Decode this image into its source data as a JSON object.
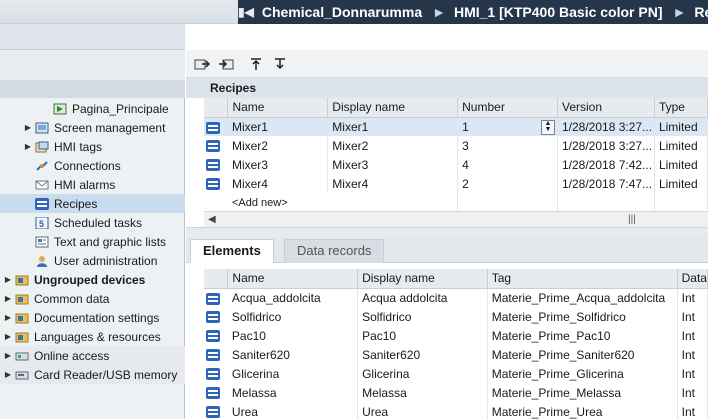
{
  "breadcrumb": {
    "items": [
      "Chemical_Donnarumma",
      "HMI_1 [KTP400 Basic color PN]",
      "Re"
    ],
    "separator": "►"
  },
  "tree": {
    "items": [
      {
        "label": "Pagina_Principale",
        "icon": "screen-icon"
      },
      {
        "label": "Screen management",
        "icon": "screen-management-icon"
      },
      {
        "label": "HMI tags",
        "icon": "tags-icon"
      },
      {
        "label": "Connections",
        "icon": "connections-icon"
      },
      {
        "label": "HMI alarms",
        "icon": "alarms-icon"
      },
      {
        "label": "Recipes",
        "icon": "recipes-icon"
      },
      {
        "label": "Scheduled tasks",
        "icon": "scheduled-tasks-icon"
      },
      {
        "label": "Text and graphic lists",
        "icon": "text-lists-icon"
      },
      {
        "label": "User administration",
        "icon": "user-admin-icon"
      },
      {
        "label": "Ungrouped devices",
        "icon": "folder-icon"
      },
      {
        "label": "Common data",
        "icon": "folder-icon"
      },
      {
        "label": "Documentation settings",
        "icon": "folder-icon"
      },
      {
        "label": "Languages & resources",
        "icon": "folder-icon"
      },
      {
        "label": "Online access",
        "icon": "online-icon"
      },
      {
        "label": "Card Reader/USB memory",
        "icon": "card-reader-icon"
      }
    ]
  },
  "recipes": {
    "title": "Recipes",
    "columns": [
      "Name",
      "Display name",
      "Number",
      "Version",
      "Type"
    ],
    "rows": [
      {
        "name": "Mixer1",
        "display": "Mixer1",
        "number": "1",
        "version": "1/28/2018 3:27...",
        "type": "Limited"
      },
      {
        "name": "Mixer2",
        "display": "Mixer2",
        "number": "3",
        "version": "1/28/2018 3:27...",
        "type": "Limited"
      },
      {
        "name": "Mixer3",
        "display": "Mixer3",
        "number": "4",
        "version": "1/28/2018 7:42...",
        "type": "Limited"
      },
      {
        "name": "Mixer4",
        "display": "Mixer4",
        "number": "2",
        "version": "1/28/2018 7:47...",
        "type": "Limited"
      }
    ],
    "add_new": "<Add new>"
  },
  "tabs": {
    "elements": "Elements",
    "data_records": "Data records"
  },
  "elements": {
    "columns": [
      "Name",
      "Display name",
      "Tag",
      "Data"
    ],
    "rows": [
      {
        "name": "Acqua_addolcita",
        "display": "Acqua addolcita",
        "tag": "Materie_Prime_Acqua_addolcita",
        "data": "Int"
      },
      {
        "name": "Solfidrico",
        "display": "Solfidrico",
        "tag": "Materie_Prime_Solfidrico",
        "data": "Int"
      },
      {
        "name": "Pac10",
        "display": "Pac10",
        "tag": "Materie_Prime_Pac10",
        "data": "Int"
      },
      {
        "name": "Saniter620",
        "display": "Saniter620",
        "tag": "Materie_Prime_Saniter620",
        "data": "Int"
      },
      {
        "name": "Glicerina",
        "display": "Glicerina",
        "tag": "Materie_Prime_Glicerina",
        "data": "Int"
      },
      {
        "name": "Melassa",
        "display": "Melassa",
        "tag": "Materie_Prime_Melassa",
        "data": "Int"
      },
      {
        "name": "Urea",
        "display": "Urea",
        "tag": "Materie_Prime_Urea",
        "data": "Int"
      }
    ]
  },
  "colors": {
    "titlebar": "#26364a",
    "selection": "#c9dcef",
    "recipe_icon": "#2c66b8"
  }
}
